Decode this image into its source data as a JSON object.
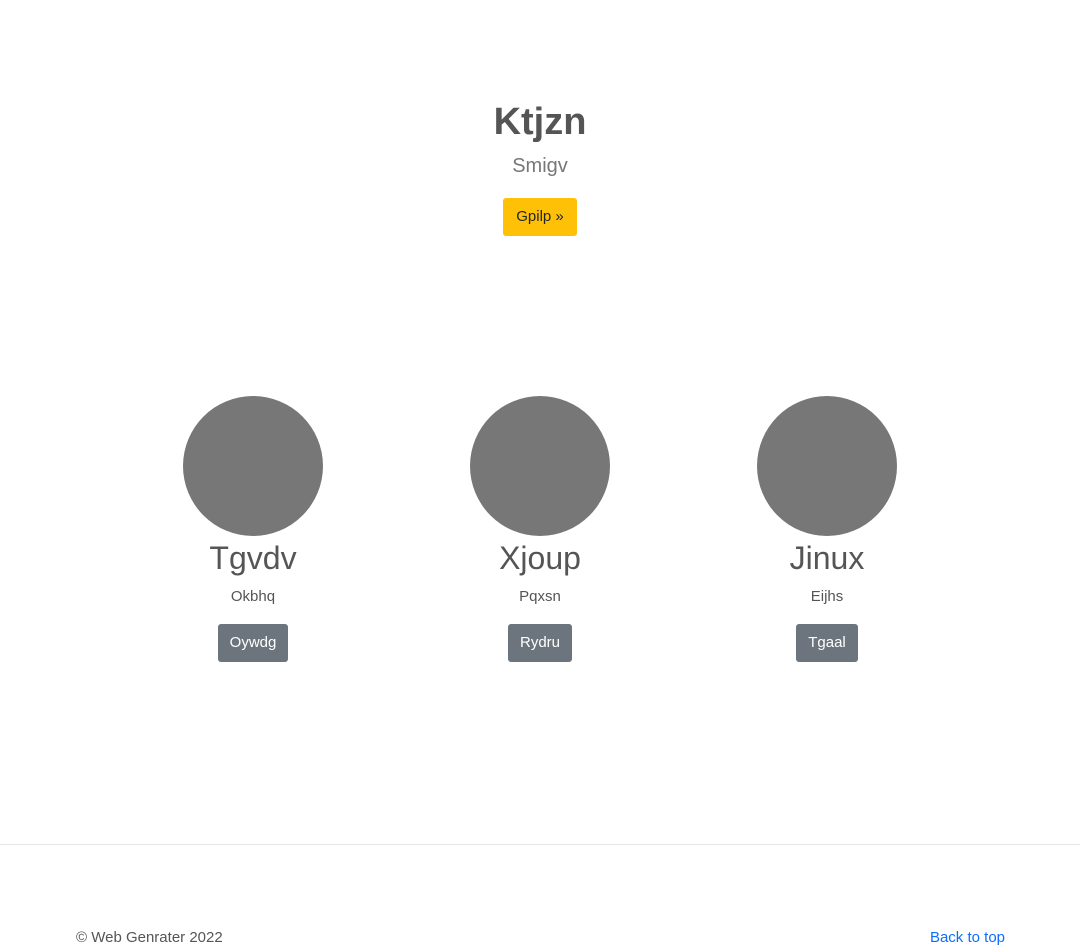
{
  "hero": {
    "title": "Ktjzn",
    "subtitle": "Smigv",
    "button_label": "Gpilp »"
  },
  "features": [
    {
      "title": "Tgvdv",
      "text": "Okbhq",
      "button_label": "Oywdg"
    },
    {
      "title": "Xjoup",
      "text": "Pqxsn",
      "button_label": "Rydru"
    },
    {
      "title": "Jinux",
      "text": "Eijhs",
      "button_label": "Tgaal"
    }
  ],
  "footer": {
    "copyright": "© Web Genrater 2022",
    "back_to_top": "Back to top"
  },
  "colors": {
    "hero_button": "#ffc107",
    "feature_button": "#6c757d",
    "avatar": "#777777",
    "link": "#0d6efd"
  }
}
